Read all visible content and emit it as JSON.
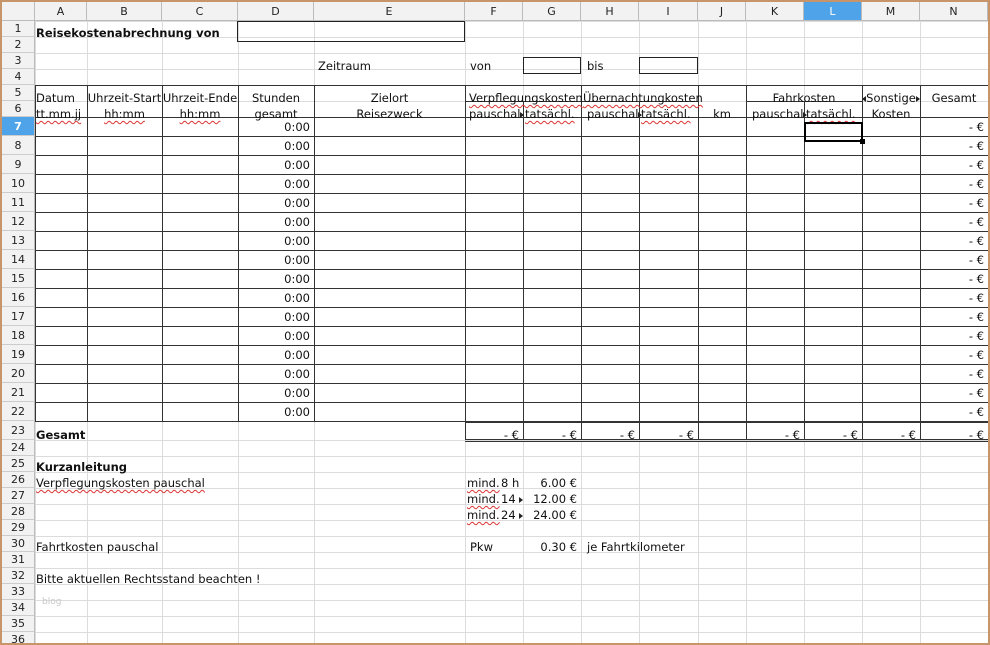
{
  "columns": [
    "A",
    "B",
    "C",
    "D",
    "E",
    "F",
    "G",
    "H",
    "I",
    "J",
    "K",
    "L",
    "M",
    "N"
  ],
  "rows": [
    "1",
    "2",
    "3",
    "4",
    "5",
    "6",
    "7",
    "8",
    "9",
    "10",
    "11",
    "12",
    "13",
    "14",
    "15",
    "16",
    "17",
    "18",
    "19",
    "20",
    "21",
    "22",
    "23",
    "24",
    "25",
    "26",
    "27",
    "28",
    "29",
    "30",
    "31",
    "32",
    "33",
    "34",
    "35",
    "36"
  ],
  "selected_cell": {
    "col": "L",
    "row": "7"
  },
  "title": "Reisekostenabrechnung von",
  "zeitraum": {
    "label": "Zeitraum",
    "von": "von",
    "bis": "bis"
  },
  "headers": {
    "datum": [
      "Datum",
      "tt.mm.jj"
    ],
    "uhrzeit_start": [
      "Uhrzeit-Start",
      "hh:mm"
    ],
    "uhrzeit_ende": [
      "Uhrzeit-Ende",
      "hh:mm"
    ],
    "stunden": [
      "Stunden",
      "gesamt"
    ],
    "zielort": [
      "Zielort",
      "Reisezweck"
    ],
    "verpflegung": "Verpflegungskosten",
    "uebernachtung": "Übernachtungkosten",
    "fahrkosten": "Fahrkosten",
    "sonstige": [
      "Sonstige",
      "Kosten"
    ],
    "gesamt": "Gesamt",
    "pauschal": "pauschal",
    "tatsaechl": "tatsächl.",
    "km": "km"
  },
  "data_rows": {
    "stunden": "0:00",
    "gesamt": "-   €"
  },
  "totals": {
    "label": "Gesamt",
    "F": "-   €",
    "G": "-   €",
    "H": "-   €",
    "I": "-   €",
    "K": "-   €",
    "L": "-   €",
    "M": "-   €",
    "N": "-   €"
  },
  "kurzanleitung": {
    "title": "Kurzanleitung",
    "verpflegung_label": "Verpflegungskosten pauschal",
    "rates": [
      {
        "label": "mind.",
        "hours": "8 h",
        "value": "6.00 €"
      },
      {
        "label": "mind.",
        "hours": "14",
        "value": "12.00 €"
      },
      {
        "label": "mind.",
        "hours": "24",
        "value": "24.00 €"
      }
    ],
    "fahrkosten_label": "Fahrtkosten pauschal",
    "pkw": "Pkw",
    "pkw_value": "0.30 €",
    "pkw_unit": "je Fahrtkilometer",
    "hinweis": "Bitte aktuellen Rechtsstand beachten !",
    "watermark": "blog"
  }
}
